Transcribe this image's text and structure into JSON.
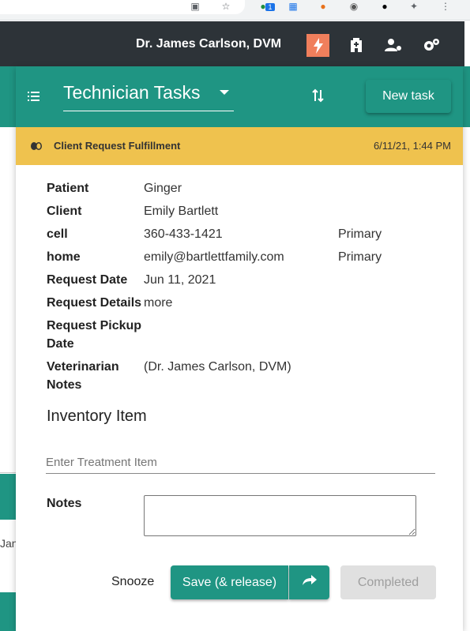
{
  "browser": {
    "extensions": [
      "screen-cast-icon",
      "star-icon",
      "extension-icon",
      "calendar-icon",
      "extension-icon",
      "extension-icon",
      "extension-icon",
      "puzzle-icon",
      "kebab-menu-icon"
    ],
    "badge_count": "1"
  },
  "appbar": {
    "user_name": "Dr. James Carlson, DVM",
    "icons": [
      "lightning-icon",
      "hospital-icon",
      "user-settings-icon",
      "gears-icon"
    ]
  },
  "panel": {
    "title": "Technician Tasks",
    "new_task_label": "New task",
    "banner": {
      "title": "Client Request Fulfillment",
      "time": "6/11/21, 1:44 PM",
      "color": "#efc24e"
    },
    "fields": {
      "patient_label": "Patient",
      "patient_value": "Ginger",
      "client_label": "Client",
      "client_value": "Emily Bartlett",
      "cell_label": "cell",
      "cell_value": "360-433-1421",
      "cell_tag": "Primary",
      "home_label": "home",
      "home_value": "emily@bartlettfamily.com",
      "home_tag": "Primary",
      "request_date_label": "Request Date",
      "request_date_value": "Jun 11, 2021",
      "request_details_label": "Request Details",
      "request_details_value": "more",
      "pickup_label_line1": "Request Pickup",
      "pickup_label_line2": "Date",
      "vet_notes_label_line1": "Veterinarian",
      "vet_notes_label_line2": "Notes",
      "vet_notes_value": "(Dr. James Carlson, DVM)"
    },
    "inventory_title": "Inventory Item",
    "treatment_placeholder": "Enter Treatment Item",
    "notes_label": "Notes",
    "actions": {
      "snooze": "Snooze",
      "save": "Save (& release)",
      "completed": "Completed"
    }
  },
  "background": {
    "left_text": "Jan"
  },
  "colors": {
    "teal": "#1f9583",
    "dark": "#2d3338",
    "alert": "#f07f5c"
  }
}
